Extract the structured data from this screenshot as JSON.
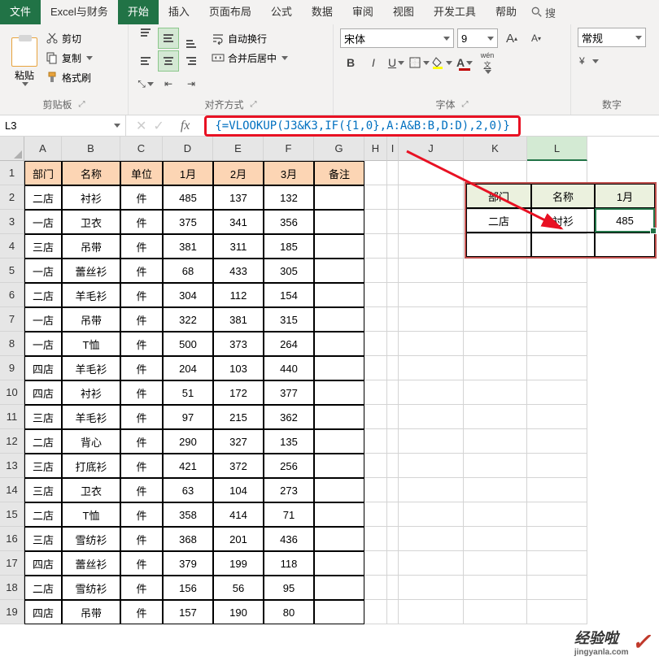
{
  "menu": {
    "items": [
      "文件",
      "Excel与财务",
      "开始",
      "插入",
      "页面布局",
      "公式",
      "数据",
      "审阅",
      "视图",
      "开发工具",
      "帮助"
    ],
    "search": "搜"
  },
  "ribbon": {
    "clipboard": {
      "paste": "粘贴",
      "cut": "剪切",
      "copy": "复制",
      "format": "格式刷",
      "label": "剪贴板"
    },
    "alignment": {
      "wrap": "自动换行",
      "merge": "合并后居中",
      "label": "对齐方式"
    },
    "font": {
      "name": "宋体",
      "size": "9",
      "label": "字体",
      "bold": "B",
      "italic": "I",
      "underline": "U",
      "wen": "wén"
    },
    "number": {
      "format": "常规",
      "label": "数字"
    }
  },
  "namebox": "L3",
  "formula": "{=VLOOKUP(J3&K3,IF({1,0},A:A&B:B,D:D),2,0)}",
  "columns": {
    "labels": [
      "A",
      "B",
      "C",
      "D",
      "E",
      "F",
      "G",
      "H",
      "I",
      "J",
      "K",
      "L"
    ],
    "widths": [
      46,
      72,
      52,
      62,
      62,
      62,
      62,
      28,
      14,
      80,
      78,
      74
    ]
  },
  "rows": [
    1,
    2,
    3,
    4,
    5,
    6,
    7,
    8,
    9,
    10,
    11,
    12,
    13,
    14,
    15,
    16,
    17,
    18,
    19
  ],
  "table": {
    "headers": [
      "部门",
      "名称",
      "单位",
      "1月",
      "2月",
      "3月",
      "备注"
    ],
    "data": [
      [
        "二店",
        "衬衫",
        "件",
        "485",
        "137",
        "132",
        ""
      ],
      [
        "一店",
        "卫衣",
        "件",
        "375",
        "341",
        "356",
        ""
      ],
      [
        "三店",
        "吊带",
        "件",
        "381",
        "311",
        "185",
        ""
      ],
      [
        "一店",
        "蕾丝衫",
        "件",
        "68",
        "433",
        "305",
        ""
      ],
      [
        "二店",
        "羊毛衫",
        "件",
        "304",
        "112",
        "154",
        ""
      ],
      [
        "一店",
        "吊带",
        "件",
        "322",
        "381",
        "315",
        ""
      ],
      [
        "一店",
        "T恤",
        "件",
        "500",
        "373",
        "264",
        ""
      ],
      [
        "四店",
        "羊毛衫",
        "件",
        "204",
        "103",
        "440",
        ""
      ],
      [
        "四店",
        "衬衫",
        "件",
        "51",
        "172",
        "377",
        ""
      ],
      [
        "三店",
        "羊毛衫",
        "件",
        "97",
        "215",
        "362",
        ""
      ],
      [
        "二店",
        "背心",
        "件",
        "290",
        "327",
        "135",
        ""
      ],
      [
        "三店",
        "打底衫",
        "件",
        "421",
        "372",
        "256",
        ""
      ],
      [
        "三店",
        "卫衣",
        "件",
        "63",
        "104",
        "273",
        ""
      ],
      [
        "二店",
        "T恤",
        "件",
        "358",
        "414",
        "71",
        ""
      ],
      [
        "三店",
        "雪纺衫",
        "件",
        "368",
        "201",
        "436",
        ""
      ],
      [
        "四店",
        "蕾丝衫",
        "件",
        "379",
        "199",
        "118",
        ""
      ],
      [
        "二店",
        "雪纺衫",
        "件",
        "156",
        "56",
        "95",
        ""
      ],
      [
        "四店",
        "吊带",
        "件",
        "157",
        "190",
        "80",
        ""
      ]
    ]
  },
  "lookup": {
    "headers": [
      "部门",
      "名称",
      "1月"
    ],
    "values": [
      "二店",
      "衬衫",
      "485"
    ]
  },
  "watermark": {
    "main": "经验啦",
    "sub": "jingyanla.com"
  }
}
